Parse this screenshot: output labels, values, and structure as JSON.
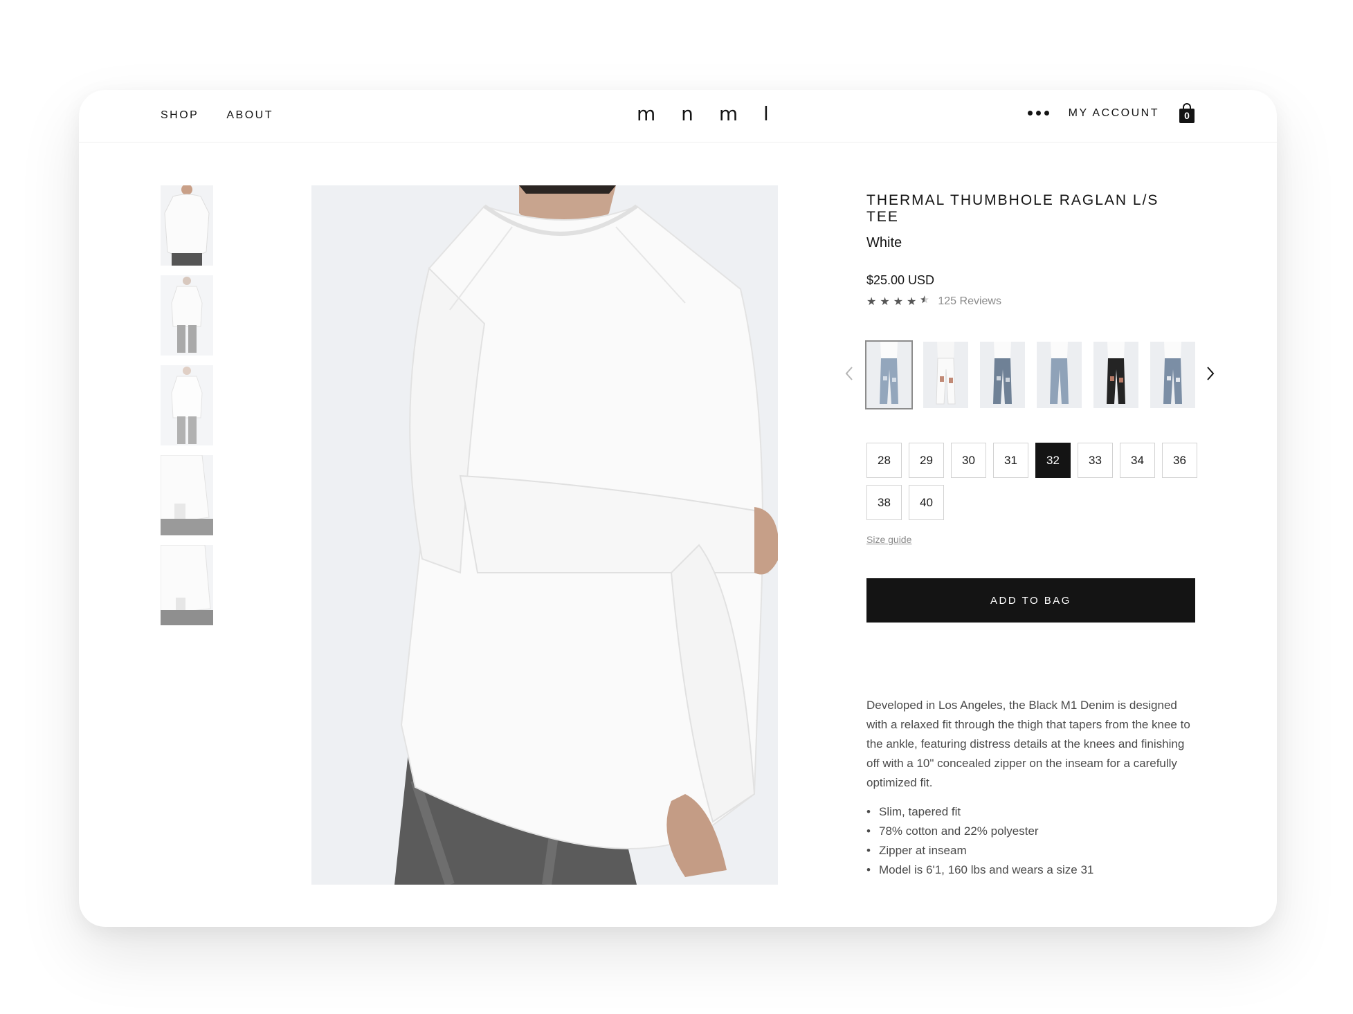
{
  "nav": {
    "left_links": [
      "SHOP",
      "ABOUT"
    ],
    "logo": "m n m l",
    "account_label": "MY ACCOUNT",
    "bag_count": "0",
    "more_icon": "more-dots-icon",
    "bag_icon": "shopping-bag-icon"
  },
  "product": {
    "title": "THERMAL THUMBHOLE RAGLAN L/S TEE",
    "color": "White",
    "price": "$25.00 USD",
    "rating": 4.5,
    "reviews_label": "125 Reviews"
  },
  "variants": {
    "selected_index": 0,
    "items": [
      "light-wash-jeans",
      "white-distressed-jeans",
      "blue-distressed-jeans",
      "light-blue-jeans",
      "black-distressed-jeans",
      "blue-ripped-jeans"
    ],
    "prev_icon": "chevron-left-icon",
    "next_icon": "chevron-right-icon"
  },
  "sizes": {
    "options": [
      "28",
      "29",
      "30",
      "31",
      "32",
      "33",
      "34",
      "36",
      "38",
      "40"
    ],
    "selected": "32",
    "guide_label": "Size guide"
  },
  "cta": {
    "add_to_bag": "ADD TO BAG"
  },
  "description": {
    "text": "Developed in Los Angeles, the Black M1 Denim is designed with a relaxed fit through the thigh that tapers from the knee to the ankle, featuring distress details at the knees and finishing off with a 10\" concealed zipper on the inseam for a carefully optimized fit.",
    "features": [
      "Slim, tapered fit",
      "78% cotton and 22% polyester",
      "Zipper at inseam",
      "Model is 6'1, 160 lbs and wears a size 31"
    ]
  },
  "colors": {
    "text": "#141414",
    "muted": "#8a8a8a",
    "body_text": "#4a4a4a",
    "button_bg": "#141414",
    "image_bg": "#eef0f3"
  }
}
